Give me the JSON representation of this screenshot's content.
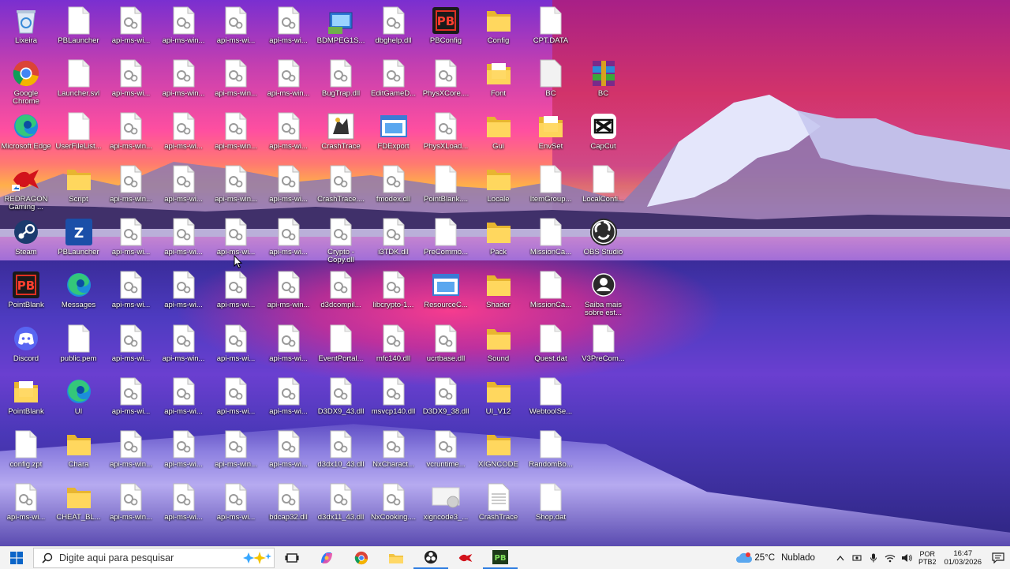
{
  "desktop": {
    "icons": [
      {
        "label": "Lixeira",
        "type": "recycle"
      },
      {
        "label": "PBLauncher",
        "type": "doc"
      },
      {
        "label": "api-ms-wi...",
        "type": "dll"
      },
      {
        "label": "api-ms-win...",
        "type": "dll"
      },
      {
        "label": "api-ms-wi...",
        "type": "dll"
      },
      {
        "label": "api-ms-wi...",
        "type": "dll"
      },
      {
        "label": "BDMPEG1S...",
        "type": "app-blue"
      },
      {
        "label": "dbghelp.dll",
        "type": "dll"
      },
      {
        "label": "PBConfig",
        "type": "app-pb"
      },
      {
        "label": "Config",
        "type": "folder"
      },
      {
        "label": "CPT.DATA",
        "type": "doc"
      },
      {
        "label": "Google Chrome",
        "type": "chrome"
      },
      {
        "label": "Launcher.svl",
        "type": "doc"
      },
      {
        "label": "api-ms-wi...",
        "type": "dll"
      },
      {
        "label": "api-ms-win...",
        "type": "dll"
      },
      {
        "label": "api-ms-win...",
        "type": "dll"
      },
      {
        "label": "api-ms-win...",
        "type": "dll"
      },
      {
        "label": "BugTrap.dll",
        "type": "dll"
      },
      {
        "label": "EditGameD...",
        "type": "dll"
      },
      {
        "label": "PhysXCore....",
        "type": "dll"
      },
      {
        "label": "Font",
        "type": "folder-doc"
      },
      {
        "label": "BC",
        "type": "doc-gray"
      },
      {
        "label": "BC",
        "type": "winrar"
      },
      {
        "label": "Microsoft Edge",
        "type": "edge"
      },
      {
        "label": "UserFileList...",
        "type": "doc"
      },
      {
        "label": "api-ms-win...",
        "type": "dll"
      },
      {
        "label": "api-ms-wi...",
        "type": "dll"
      },
      {
        "label": "api-ms-win...",
        "type": "dll"
      },
      {
        "label": "api-ms-wi...",
        "type": "dll"
      },
      {
        "label": "CrashTrace",
        "type": "app-crash"
      },
      {
        "label": "FDExport",
        "type": "app-window"
      },
      {
        "label": "PhysXLoad...",
        "type": "dll"
      },
      {
        "label": "Gui",
        "type": "folder"
      },
      {
        "label": "EnvSet",
        "type": "folder-doc"
      },
      {
        "label": "CapCut",
        "type": "capcut"
      },
      {
        "label": "REDRAGON Gaming ...",
        "type": "redragon"
      },
      {
        "label": "Script",
        "type": "folder"
      },
      {
        "label": "api-ms-win...",
        "type": "dll"
      },
      {
        "label": "api-ms-wi...",
        "type": "dll"
      },
      {
        "label": "api-ms-win...",
        "type": "dll"
      },
      {
        "label": "api-ms-wi...",
        "type": "dll"
      },
      {
        "label": "CrashTrace....",
        "type": "dll"
      },
      {
        "label": "fmodex.dll",
        "type": "dll"
      },
      {
        "label": "PointBlank....",
        "type": "doc"
      },
      {
        "label": "Locale",
        "type": "folder"
      },
      {
        "label": "ItemGroup...",
        "type": "doc"
      },
      {
        "label": "LocalConfi...",
        "type": "doc"
      },
      {
        "label": "Steam",
        "type": "steam"
      },
      {
        "label": "PBLauncher",
        "type": "app-pbl"
      },
      {
        "label": "api-ms-wi...",
        "type": "dll"
      },
      {
        "label": "api-ms-wi...",
        "type": "dll"
      },
      {
        "label": "api-ms-wi...",
        "type": "dll"
      },
      {
        "label": "api-ms-wi...",
        "type": "dll"
      },
      {
        "label": "Crypto - Copy.dll",
        "type": "dll"
      },
      {
        "label": "i3TDK.dll",
        "type": "dll"
      },
      {
        "label": "PreCommo...",
        "type": "doc"
      },
      {
        "label": "Pack",
        "type": "folder"
      },
      {
        "label": "MissionCa...",
        "type": "doc"
      },
      {
        "label": "OBS Studio",
        "type": "obs"
      },
      {
        "label": "PointBlank",
        "type": "app-pb"
      },
      {
        "label": "Messages",
        "type": "edge"
      },
      {
        "label": "api-ms-wi...",
        "type": "dll"
      },
      {
        "label": "api-ms-wi...",
        "type": "dll"
      },
      {
        "label": "api-ms-wi...",
        "type": "dll"
      },
      {
        "label": "api-ms-win...",
        "type": "dll"
      },
      {
        "label": "d3dcompil...",
        "type": "dll"
      },
      {
        "label": "libcrypto-1...",
        "type": "dll"
      },
      {
        "label": "ResourceC...",
        "type": "app-window"
      },
      {
        "label": "Shader",
        "type": "folder"
      },
      {
        "label": "MissionCa...",
        "type": "doc"
      },
      {
        "label": "Saiba mais sobre est...",
        "type": "saiba"
      },
      {
        "label": "Discord",
        "type": "discord"
      },
      {
        "label": "public.pem",
        "type": "doc"
      },
      {
        "label": "api-ms-wi...",
        "type": "dll"
      },
      {
        "label": "api-ms-win...",
        "type": "dll"
      },
      {
        "label": "api-ms-wi...",
        "type": "dll"
      },
      {
        "label": "api-ms-wi...",
        "type": "dll"
      },
      {
        "label": "EventPortal...",
        "type": "doc"
      },
      {
        "label": "mfc140.dll",
        "type": "dll"
      },
      {
        "label": "ucrtbase.dll",
        "type": "dll"
      },
      {
        "label": "Sound",
        "type": "folder"
      },
      {
        "label": "Quest.dat",
        "type": "doc"
      },
      {
        "label": "V3PreCom...",
        "type": "doc"
      },
      {
        "label": "PointBlank",
        "type": "folder-doc"
      },
      {
        "label": "UI",
        "type": "edge"
      },
      {
        "label": "api-ms-wi...",
        "type": "dll"
      },
      {
        "label": "api-ms-wi...",
        "type": "dll"
      },
      {
        "label": "api-ms-wi...",
        "type": "dll"
      },
      {
        "label": "api-ms-wi...",
        "type": "dll"
      },
      {
        "label": "D3DX9_43.dll",
        "type": "dll"
      },
      {
        "label": "msvcp140.dll",
        "type": "dll"
      },
      {
        "label": "D3DX9_38.dll",
        "type": "dll"
      },
      {
        "label": "UI_V12",
        "type": "folder"
      },
      {
        "label": "WebtoolSe...",
        "type": "doc"
      },
      {
        "label": "config.zpt",
        "type": "doc"
      },
      {
        "label": "Chara",
        "type": "folder"
      },
      {
        "label": "api-ms-win...",
        "type": "dll"
      },
      {
        "label": "api-ms-wi...",
        "type": "dll"
      },
      {
        "label": "api-ms-win...",
        "type": "dll"
      },
      {
        "label": "api-ms-wi...",
        "type": "dll"
      },
      {
        "label": "d3dx10_43.dll",
        "type": "dll"
      },
      {
        "label": "NxCharact...",
        "type": "dll"
      },
      {
        "label": "vcruntime...",
        "type": "dll"
      },
      {
        "label": "XIGNCODE",
        "type": "folder"
      },
      {
        "label": "RandomBo...",
        "type": "doc"
      },
      {
        "label": "api-ms-wi...",
        "type": "dll"
      },
      {
        "label": "CHEAT_BL...",
        "type": "folder"
      },
      {
        "label": "api-ms-win...",
        "type": "dll"
      },
      {
        "label": "api-ms-wi...",
        "type": "dll"
      },
      {
        "label": "api-ms-wi...",
        "type": "dll"
      },
      {
        "label": "bdcap32.dll",
        "type": "dll"
      },
      {
        "label": "d3dx11_43.dll",
        "type": "dll"
      },
      {
        "label": "NxCooking....",
        "type": "dll"
      },
      {
        "label": "xigncode3_...",
        "type": "app-gear"
      },
      {
        "label": "CrashTrace",
        "type": "doc-lines"
      },
      {
        "label": "Shop.dat",
        "type": "doc"
      }
    ]
  },
  "taskbar": {
    "search_placeholder": "Digite aqui para pesquisar",
    "apps": [
      "task-view",
      "copilot",
      "chrome",
      "file-explorer",
      "obs",
      "redragon",
      "pointblank"
    ],
    "weather_temp": "25°C",
    "weather_desc": "Nublado",
    "lang_line1": "POR",
    "lang_line2": "PTB2",
    "time": "16:47",
    "date": "01/03/2026"
  }
}
